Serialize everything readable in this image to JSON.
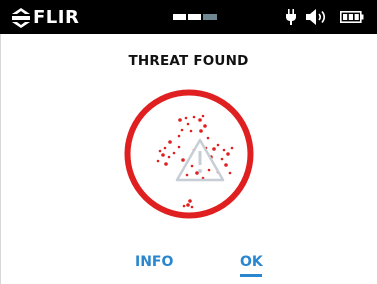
{
  "status_bar": {
    "brand": "FLIR",
    "page_indicator": {
      "count": 3,
      "active": [
        true,
        true,
        false
      ]
    },
    "icons": [
      "flir-logo-icon",
      "plug-icon",
      "speaker-icon",
      "battery-icon"
    ],
    "battery_level": 1.0
  },
  "screen": {
    "title": "THREAT FOUND",
    "alert_icon": "threat-warning-icon",
    "alert_color": "#e02020"
  },
  "actions": {
    "info_label": "INFO",
    "ok_label": "OK",
    "selected": "OK",
    "accent_color": "#2a86cf"
  }
}
